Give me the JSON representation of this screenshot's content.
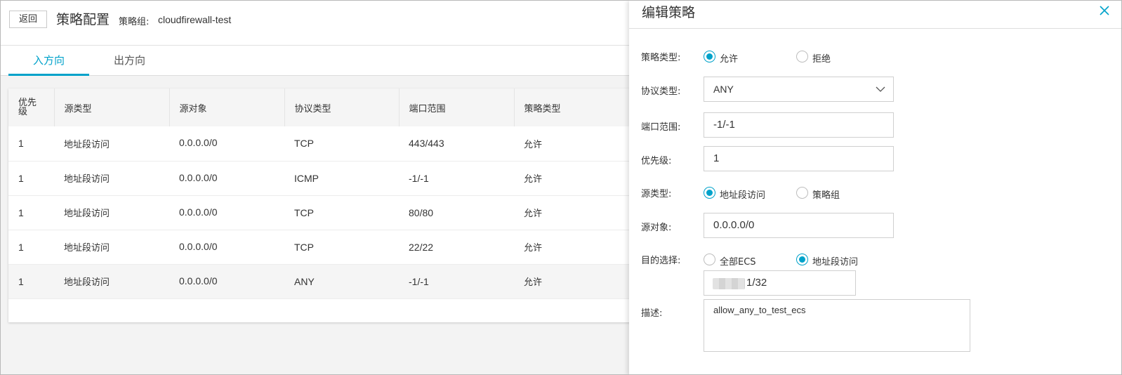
{
  "header": {
    "back_label": "返回",
    "title": "策略配置",
    "group_label": "策略组:",
    "group_value": "cloudfirewall-test"
  },
  "tabs": [
    {
      "label": "入方向",
      "active": true
    },
    {
      "label": "出方向",
      "active": false
    }
  ],
  "table": {
    "columns": [
      "优先级",
      "源类型",
      "源对象",
      "协议类型",
      "端口范围",
      "策略类型"
    ],
    "rows": [
      {
        "priority": "1",
        "source_type": "地址段访问",
        "source_object": "0.0.0.0/0",
        "protocol": "TCP",
        "port_range": "443/443",
        "policy": "允许"
      },
      {
        "priority": "1",
        "source_type": "地址段访问",
        "source_object": "0.0.0.0/0",
        "protocol": "ICMP",
        "port_range": "-1/-1",
        "policy": "允许"
      },
      {
        "priority": "1",
        "source_type": "地址段访问",
        "source_object": "0.0.0.0/0",
        "protocol": "TCP",
        "port_range": "80/80",
        "policy": "允许"
      },
      {
        "priority": "1",
        "source_type": "地址段访问",
        "source_object": "0.0.0.0/0",
        "protocol": "TCP",
        "port_range": "22/22",
        "policy": "允许"
      },
      {
        "priority": "1",
        "source_type": "地址段访问",
        "source_object": "0.0.0.0/0",
        "protocol": "ANY",
        "port_range": "-1/-1",
        "policy": "允许"
      }
    ]
  },
  "drawer": {
    "title": "编辑策略",
    "policy_type": {
      "label": "策略类型:",
      "options": [
        "允许",
        "拒绝"
      ],
      "selected": "允许"
    },
    "protocol": {
      "label": "协议类型:",
      "value": "ANY"
    },
    "port_range": {
      "label": "端口范围:",
      "value": "-1/-1"
    },
    "priority": {
      "label": "优先级:",
      "value": "1"
    },
    "source_type": {
      "label": "源类型:",
      "options": [
        "地址段访问",
        "策略组"
      ],
      "selected": "地址段访问"
    },
    "source_object": {
      "label": "源对象:",
      "value": "0.0.0.0/0"
    },
    "destination": {
      "label": "目的选择:",
      "options": [
        "全部ECS",
        "地址段访问"
      ],
      "selected": "地址段访问",
      "address_suffix": "1/32"
    },
    "description": {
      "label": "描述:",
      "value": "allow_any_to_test_ecs"
    }
  },
  "colors": {
    "accent": "#00a2ca",
    "row_highlight": "#f5f5f5"
  },
  "icons": {
    "close": "close-icon",
    "dropdown": "chevron-down-icon"
  }
}
